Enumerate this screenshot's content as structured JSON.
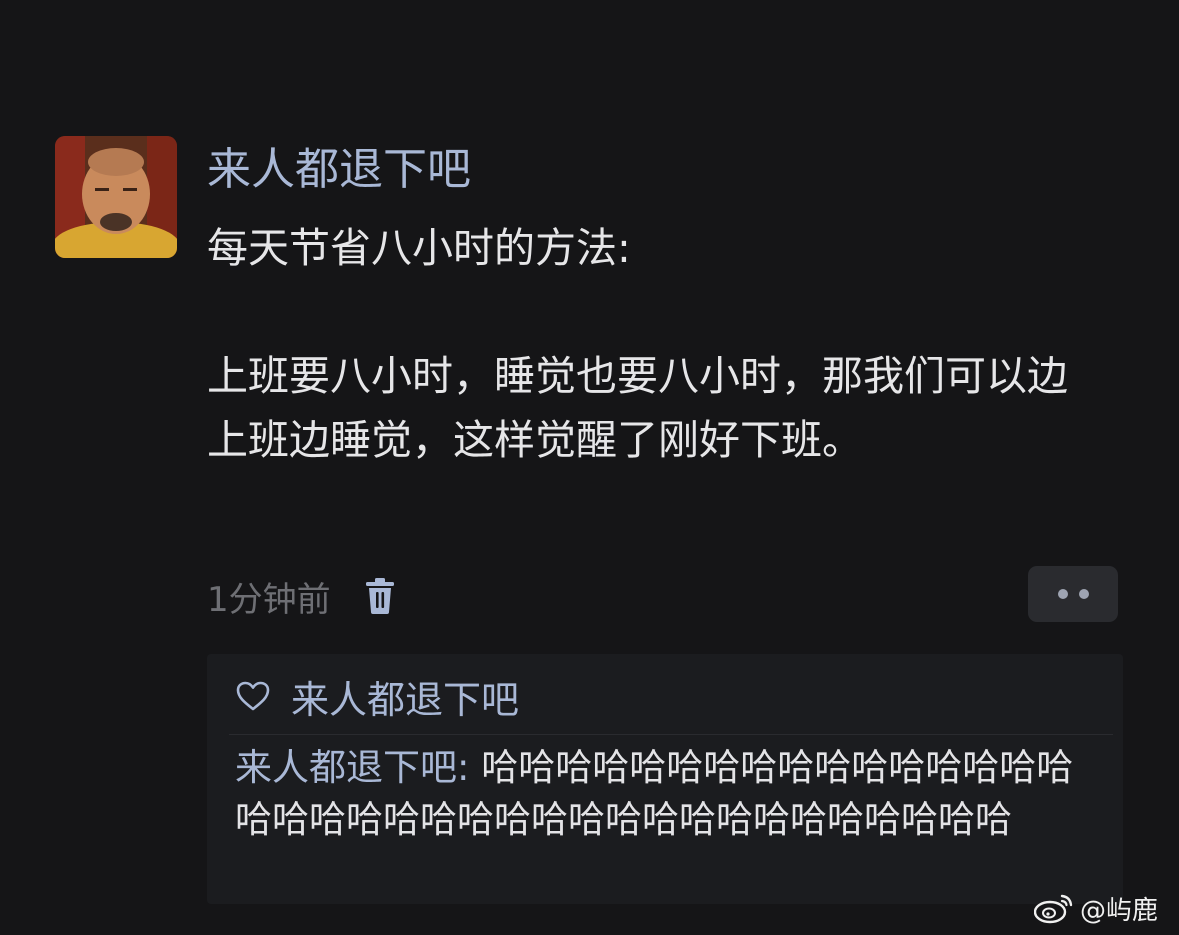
{
  "post": {
    "author": "来人都退下吧",
    "title_line": "每天节省八小时的方法:",
    "body": "上班要八小时，睡觉也要八小时，那我们可以边上班边睡觉，这样觉醒了刚好下班。",
    "time": "1分钟前"
  },
  "icons": {
    "delete": "trash-icon",
    "more": "more-dots-icon",
    "like": "heart-outline-icon",
    "watermark": "weibo-logo-icon"
  },
  "likes": {
    "users": "来人都退下吧"
  },
  "reply": {
    "author": "来人都退下吧",
    "separator": ": ",
    "text": "哈哈哈哈哈哈哈哈哈哈哈哈哈哈哈哈哈哈哈哈哈哈哈哈哈哈哈哈哈哈哈哈哈哈哈哈哈"
  },
  "watermark": {
    "handle": "@屿鹿"
  },
  "colors": {
    "background": "#151517",
    "name_blue": "#a9b8d6",
    "muted": "#6e6f74",
    "panel": "#1b1c1f"
  }
}
